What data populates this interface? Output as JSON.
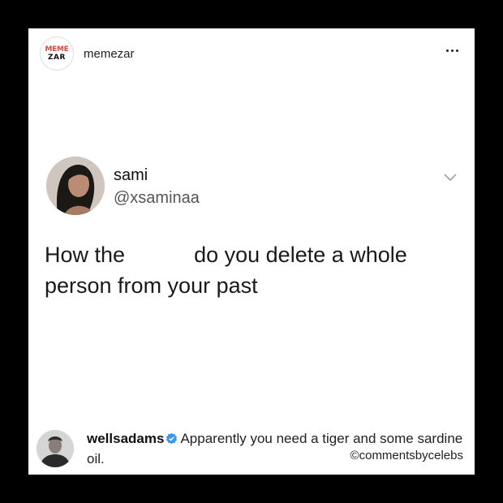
{
  "post": {
    "account_name": "memezar",
    "logo_text_line1": "MEME",
    "logo_text_line2": "ZAR",
    "more_icon": "more-horizontal-icon"
  },
  "tweet": {
    "display_name": "sami",
    "handle": "@xsaminaa",
    "text_part1": "How the",
    "text_part2": "do you delete a whole person from your past",
    "chevron_icon": "chevron-down-icon"
  },
  "comment": {
    "username": "wellsadams",
    "verified_icon": "verified-badge-icon",
    "text": "Apparently you need a tiger and some sardine oil.",
    "credit": "©commentsbycelebs"
  },
  "colors": {
    "background": "#000000",
    "card": "#ffffff",
    "verified_blue": "#3897f0",
    "logo_red": "#e0453c"
  }
}
